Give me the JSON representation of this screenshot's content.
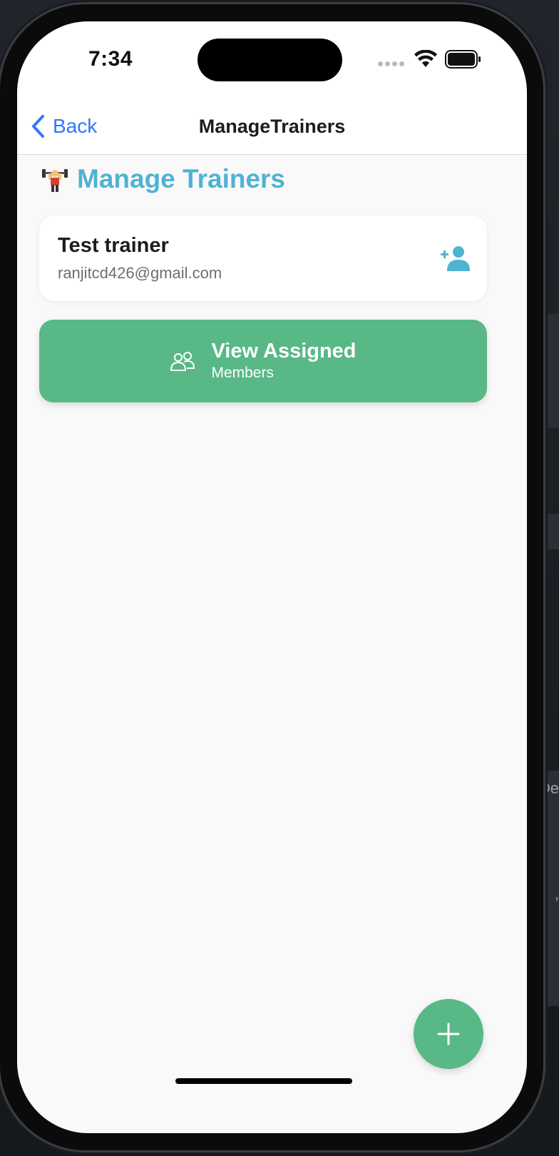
{
  "status_bar": {
    "time": "7:34"
  },
  "nav": {
    "back_label": "Back",
    "title": "ManageTrainers"
  },
  "page": {
    "title": "Manage Trainers"
  },
  "trainers": [
    {
      "name": "Test trainer",
      "email": "ranjitcd426@gmail.com"
    }
  ],
  "view_assigned": {
    "title": "View Assigned",
    "subtitle": "Members"
  },
  "background": {
    "edge_text_1": "De",
    "edge_text_2": ", "
  },
  "colors": {
    "accent_blue": "#4fb3d4",
    "ios_blue": "#3478f6",
    "green": "#58b886",
    "background": "#f9f9f9"
  },
  "icons": {
    "title_icon": "weightlifter-icon",
    "assign": "add-user-icon",
    "members": "members-icon",
    "fab": "plus-icon"
  }
}
